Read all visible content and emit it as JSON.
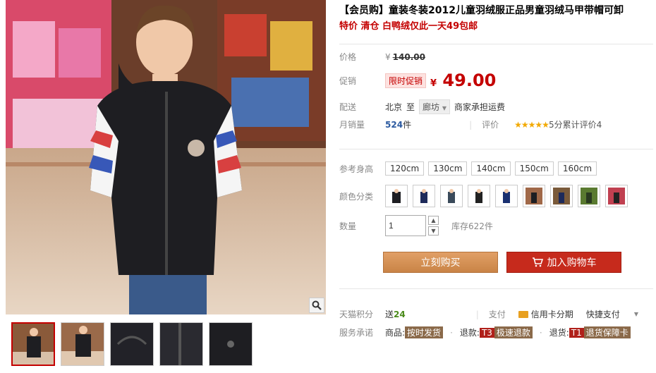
{
  "product": {
    "title": "【会员购】童装冬装2012儿童羽绒服正品男童羽绒马甲带帽可卸",
    "promo_line": "特价 清仓 白鸭绒仅此一天49包邮"
  },
  "price": {
    "label": "价格",
    "currency": "¥",
    "original": "140.00"
  },
  "sale": {
    "label": "促销",
    "badge": "限时促销",
    "currency": "¥",
    "value": "49.00"
  },
  "shipping": {
    "label": "配送",
    "from": "北京",
    "to_word": "至",
    "to_city": "廊坊",
    "note": "商家承担运费"
  },
  "sales": {
    "label": "月销量",
    "count": "524",
    "unit": "件",
    "rating_label": "评价",
    "stars": "★★★★★",
    "rating_text": "5分累计评价4"
  },
  "height": {
    "label": "参考身高",
    "options": [
      "120cm",
      "130cm",
      "140cm",
      "150cm",
      "160cm"
    ]
  },
  "color": {
    "label": "颜色分类"
  },
  "quantity": {
    "label": "数量",
    "value": "1",
    "up": "▲",
    "down": "▼",
    "stock": "库存622件"
  },
  "buttons": {
    "buy": "立刻购买",
    "cart": "加入购物车"
  },
  "points": {
    "label": "天猫积分",
    "send": "送",
    "value": "24",
    "pay_label": "支付",
    "credit": "信用卡分期",
    "quick": "快捷支付"
  },
  "service": {
    "label": "服务承诺",
    "goods": "商品:",
    "goods_tag": "按时发货",
    "refund": "退款:",
    "refund_code": "T3",
    "refund_tag": "极速退款",
    "return": "退货:",
    "return_code": "T1",
    "return_tag": "退货保障卡",
    "sep": "·"
  },
  "colors": {
    "accent": "#c40000",
    "buy_button": "#d8925a",
    "cart_button": "#c62a1c"
  }
}
